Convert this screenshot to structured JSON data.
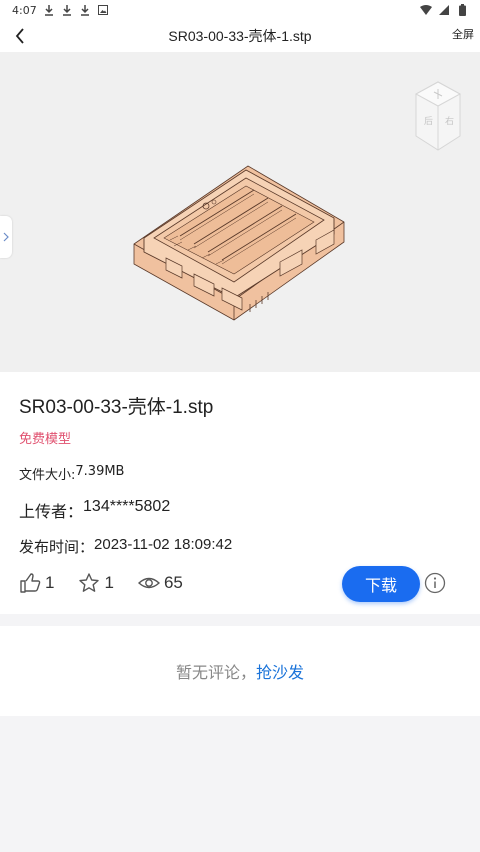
{
  "status_bar": {
    "time": "4:07",
    "left_icons": [
      "download-icon",
      "download-icon",
      "download-icon",
      "image-icon"
    ],
    "right_icons": [
      "wifi-icon",
      "signal-icon",
      "battery-icon"
    ]
  },
  "header": {
    "title": "SR03-00-33-壳体-1.stp",
    "fullscreen_label": "全屏"
  },
  "file": {
    "name": "SR03-00-33-壳体-1.stp",
    "tag": "免费模型",
    "size_label": "文件大小:",
    "size_value": "7.39MB",
    "uploader_label": "上传者：",
    "uploader_value": "134****5802",
    "time_label": "发布时间：",
    "time_value": "2023-11-02 18:09:42"
  },
  "stats": {
    "likes": "1",
    "favorites": "1",
    "views": "65"
  },
  "actions": {
    "download_label": "下载"
  },
  "comments": {
    "empty_text": "暂无评论，",
    "sofa_link": "抢沙发"
  },
  "colors": {
    "accent": "#1a6cf0",
    "tag": "#e0516f",
    "model": "#f3c7a6",
    "link": "#1a73d9"
  }
}
